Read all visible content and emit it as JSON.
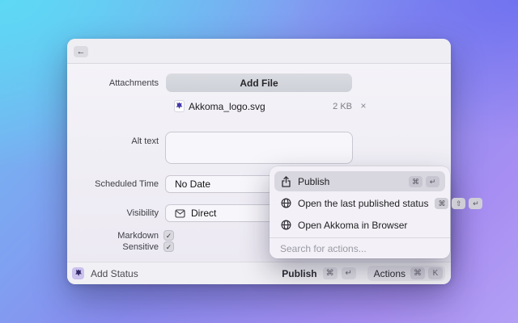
{
  "titlebar": {
    "back_icon": "←"
  },
  "form": {
    "attachments_label": "Attachments",
    "add_file_button": "Add File",
    "file": {
      "name": "Akkoma_logo.svg",
      "size": "2 KB",
      "remove_icon": "×"
    },
    "alt_text_label": "Alt text",
    "alt_text_value": "",
    "scheduled_time_label": "Scheduled Time",
    "scheduled_time_value": "No Date",
    "visibility_label": "Visibility",
    "visibility_value": "Direct",
    "markdown_label": "Markdown",
    "markdown_check": "✓",
    "sensitive_label": "Sensitive",
    "sensitive_check": "✓"
  },
  "status_bar": {
    "app_label": "Add Status",
    "publish_label": "Publish",
    "publish_keys": [
      "⌘",
      "↵"
    ],
    "actions_label": "Actions",
    "actions_keys": [
      "⌘",
      "K"
    ]
  },
  "command_palette": {
    "items": [
      {
        "label": "Publish",
        "icon": "upload-icon",
        "keys": [
          "⌘",
          "↵"
        ],
        "highlighted": true
      },
      {
        "label": "Open the last published status",
        "icon": "globe-icon",
        "keys": [
          "⌘",
          "⇧",
          "↵"
        ],
        "highlighted": false
      },
      {
        "label": "Open Akkoma in Browser",
        "icon": "globe-icon",
        "keys": [],
        "highlighted": false
      }
    ],
    "search_placeholder": "Search for actions..."
  },
  "colors": {
    "desktop_cyan": "#5CDAF4",
    "desktop_blue": "#8A8CF0",
    "desktop_purple": "#A78EF2",
    "window_bg": "#F2F1F6",
    "palette_highlight": "#D8D6DF",
    "accent_lavender": "#CBC2EE"
  }
}
